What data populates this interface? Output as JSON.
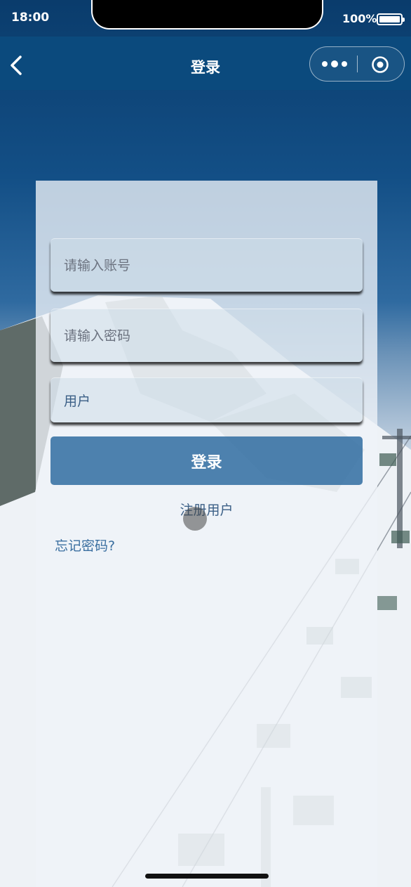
{
  "status_bar": {
    "time": "18:00",
    "battery": "100%"
  },
  "nav": {
    "title": "登录"
  },
  "form": {
    "account_placeholder": "请输入账号",
    "password_placeholder": "请输入密码",
    "user_type_value": "用户",
    "login_label": "登录",
    "register_label": "注册用户",
    "forgot_label": "忘记密码?"
  },
  "colors": {
    "nav_background": "#0b4a7d",
    "button_background": "#2a689e",
    "link_text": "#3b5f86"
  }
}
